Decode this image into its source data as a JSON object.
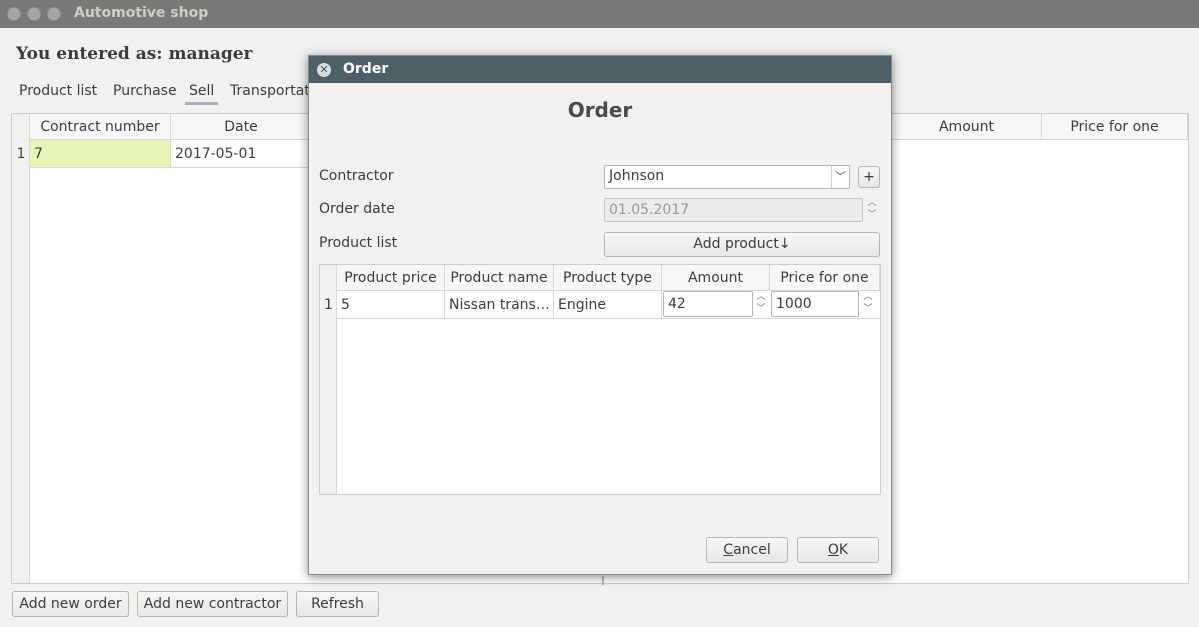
{
  "window": {
    "title": "Automotive shop"
  },
  "user_heading": "You entered as: manager",
  "tabs": [
    "Product list",
    "Purchase",
    "Sell",
    "Transportat"
  ],
  "main_table": {
    "headers": [
      "Contract number",
      "Date",
      "Amount",
      "Price for one"
    ],
    "rows": [
      {
        "num": "1",
        "contract": "7",
        "date": "2017-05-01"
      }
    ]
  },
  "buttons": {
    "add_order": "Add new order",
    "add_contractor": "Add new contractor",
    "refresh": "Refresh"
  },
  "dialog": {
    "title": "Order",
    "heading": "Order",
    "contractor_label": "Contractor",
    "contractor_value": "Johnson",
    "plus": "+",
    "order_date_label": "Order date",
    "order_date_value": "01.05.2017",
    "product_list_label": "Product list",
    "add_product": "Add product↓",
    "table": {
      "headers": [
        "Product price",
        "Product name",
        "Product type",
        "Amount",
        "Price for one"
      ],
      "rows": [
        {
          "num": "1",
          "price": "5",
          "name": "Nissan trans…",
          "type": "Engine",
          "amount": "42",
          "price_one": "1000"
        }
      ]
    },
    "cancel_rest": "ancel",
    "cancel_mnemonic": "C",
    "ok_rest": "K",
    "ok_mnemonic": "O"
  },
  "icons": {
    "close": "close-icon",
    "dropdown": "chevron-down-icon",
    "spin_up": "spin-up-icon",
    "spin_down": "spin-down-icon"
  }
}
